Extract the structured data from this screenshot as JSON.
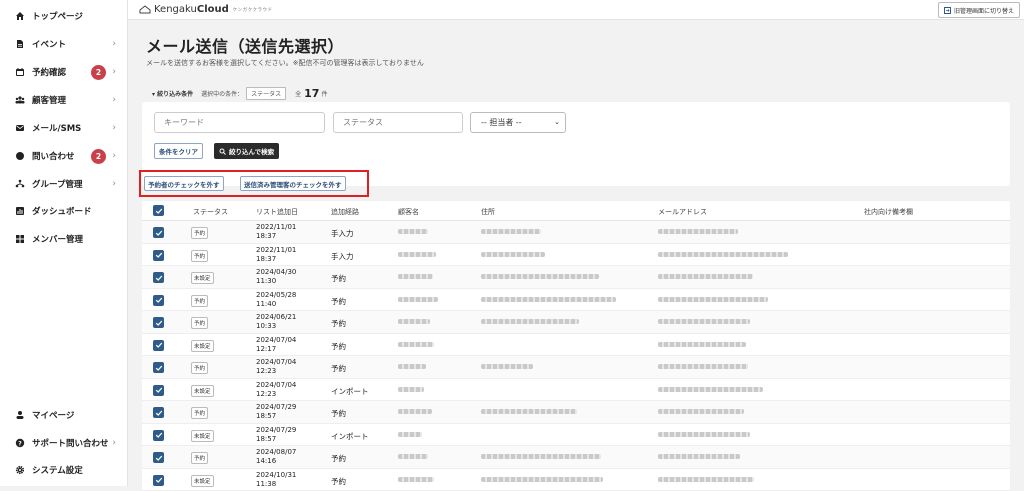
{
  "sidebar": {
    "items": [
      {
        "label": "トップページ",
        "icon": "home-icon",
        "badge": "",
        "chevron": false
      },
      {
        "label": "イベント",
        "icon": "document-icon",
        "badge": "",
        "chevron": true
      },
      {
        "label": "予約確認",
        "icon": "calendar-icon",
        "badge": "2",
        "chevron": true
      },
      {
        "label": "顧客管理",
        "icon": "users-icon",
        "badge": "",
        "chevron": true
      },
      {
        "label": "メール/SMS",
        "icon": "mail-icon",
        "badge": "",
        "chevron": true
      },
      {
        "label": "問い合わせ",
        "icon": "chat-icon",
        "badge": "2",
        "chevron": true
      },
      {
        "label": "グループ管理",
        "icon": "group-icon",
        "badge": "",
        "chevron": true
      },
      {
        "label": "ダッシュボード",
        "icon": "chart-icon",
        "badge": "",
        "chevron": false
      },
      {
        "label": "メンバー管理",
        "icon": "grid-icon",
        "badge": "",
        "chevron": false
      }
    ],
    "bottom_items": [
      {
        "label": "マイページ",
        "icon": "person-icon",
        "chevron": false
      },
      {
        "label": "サポート問い合わせ",
        "icon": "help-icon",
        "chevron": true
      },
      {
        "label": "システム設定",
        "icon": "gear-icon",
        "chevron": false
      }
    ]
  },
  "topbar": {
    "brand_light": "Kengaku",
    "brand_bold": "Cloud",
    "brand_kana": "ケンガククラウド",
    "switch_label": "旧管理画面に切り替え"
  },
  "page": {
    "title": "メール送信（送信先選択）",
    "description": "メールを送信するお客様を選択してください。※配信不可の管理客は表示しておりません"
  },
  "filter": {
    "toggle_label": "▾ 絞り込み条件",
    "selected_label": "選択中の条件：",
    "selected_condition": "ステータス",
    "count_prefix": "全",
    "count": "17",
    "count_unit": "件",
    "keyword_placeholder": "キーワード",
    "status_placeholder": "ステータス",
    "assignee_selected": "-- 担当者 --",
    "clear_label": "条件をクリア",
    "search_label": "絞り込んで検索"
  },
  "actions": {
    "uncheck_reservers": "予約者のチェックを外す",
    "uncheck_sent": "送信済み管理客のチェックを外す"
  },
  "table": {
    "headers": [
      "ステータス",
      "リスト追加日",
      "追加経路",
      "顧客名",
      "住所",
      "メールアドレス",
      "社内向け備考欄"
    ],
    "rows": [
      {
        "status": "予約",
        "date": "2022/11/01",
        "time": "18:37",
        "route": "手入力"
      },
      {
        "status": "予約",
        "date": "2022/11/01",
        "time": "18:37",
        "route": "手入力"
      },
      {
        "status": "未設定",
        "date": "2024/04/30",
        "time": "11:30",
        "route": "予約"
      },
      {
        "status": "予約",
        "date": "2024/05/28",
        "time": "11:40",
        "route": "予約"
      },
      {
        "status": "予約",
        "date": "2024/06/21",
        "time": "10:33",
        "route": "予約"
      },
      {
        "status": "未設定",
        "date": "2024/07/04",
        "time": "12:17",
        "route": "予約"
      },
      {
        "status": "予約",
        "date": "2024/07/04",
        "time": "12:23",
        "route": "予約"
      },
      {
        "status": "未設定",
        "date": "2024/07/04",
        "time": "12:23",
        "route": "インポート"
      },
      {
        "status": "予約",
        "date": "2024/07/29",
        "time": "18:57",
        "route": "予約"
      },
      {
        "status": "未設定",
        "date": "2024/07/29",
        "time": "18:57",
        "route": "インポート"
      },
      {
        "status": "予約",
        "date": "2024/08/07",
        "time": "14:16",
        "route": "予約"
      },
      {
        "status": "未設定",
        "date": "2024/10/31",
        "time": "11:38",
        "route": "予約"
      }
    ]
  },
  "colors": {
    "accent": "#2f5b8a",
    "badge": "#c9404a",
    "highlight_frame": "#e02020"
  }
}
